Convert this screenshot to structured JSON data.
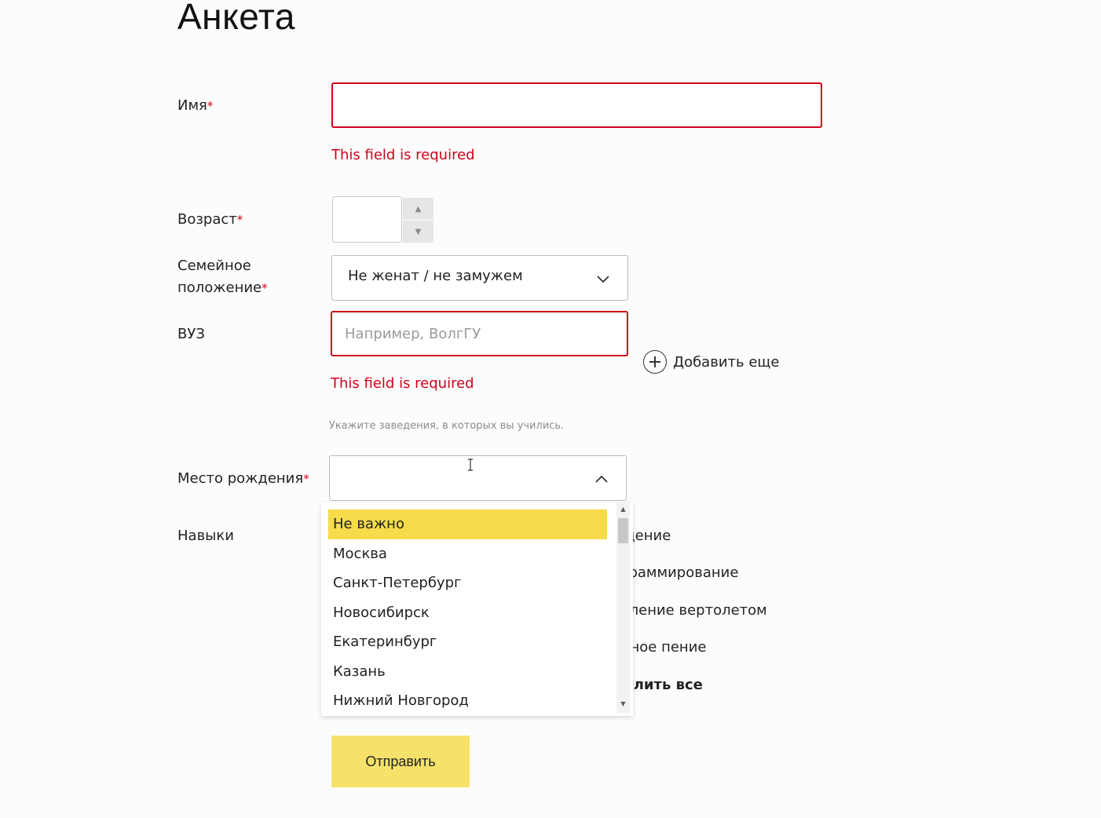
{
  "page": {
    "title": "Анкета"
  },
  "colors": {
    "error": "#d0021b",
    "accent": "#f6dc4a",
    "button": "#f7e16b"
  },
  "form": {
    "name": {
      "label": "Имя",
      "required_mark": "*",
      "value": "",
      "error": "This field is required"
    },
    "age": {
      "label": "Возраст",
      "required_mark": "*",
      "value": "",
      "spin_up_icon": "triangle-up",
      "spin_down_icon": "triangle-down"
    },
    "marital": {
      "label_line1": "Семейное",
      "label_line2": "положение",
      "required_mark": "*",
      "value": "Не женат / не замужем",
      "icon": "chevron-down"
    },
    "university": {
      "label": "ВУЗ",
      "placeholder": "Например, ВолгГУ",
      "error": "This field is required",
      "hint": "Укажите заведения, в которых вы учились.",
      "add_more": "Добавить еще",
      "add_icon": "plus-circle"
    },
    "birthplace": {
      "label": "Место рождения",
      "required_mark": "*",
      "value": "",
      "icon": "chevron-up",
      "options": [
        "Не важно",
        "Москва",
        "Санкт-Петербург",
        "Новосибирск",
        "Екатеринбург",
        "Казань",
        "Нижний Новгород"
      ],
      "highlighted": "Не важно"
    },
    "skills": {
      "label": "Навыки",
      "items": [
        "ждение",
        "ограммирование",
        "авление вертолетом",
        "ерное пение"
      ],
      "select_all": "делить все"
    },
    "submit_label": "Отправить"
  }
}
